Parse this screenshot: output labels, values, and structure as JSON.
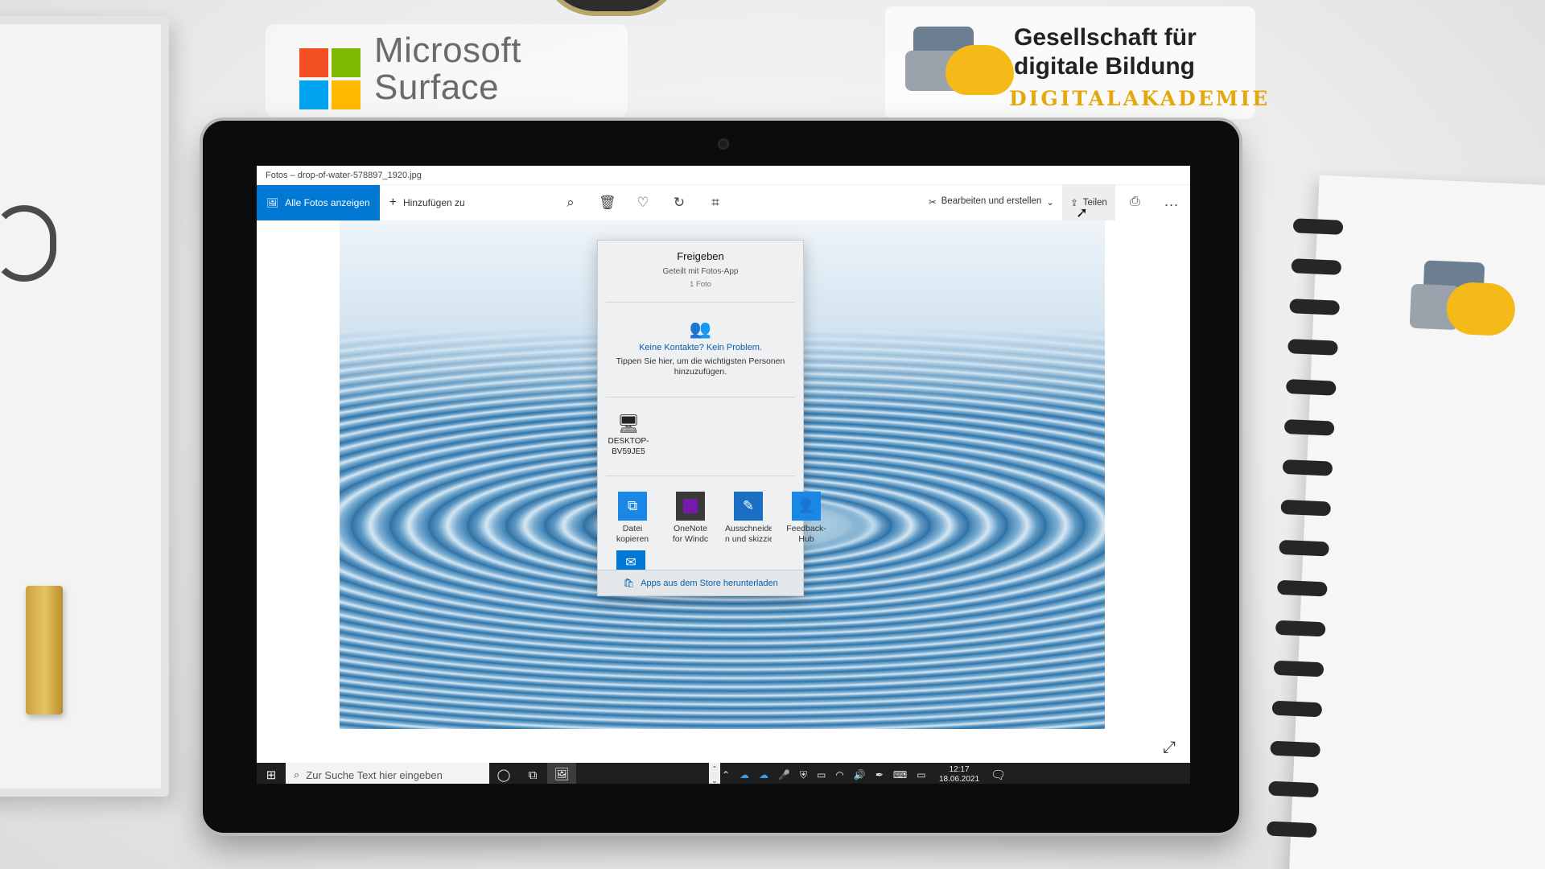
{
  "desk": {
    "ms_brand": "Microsoft Surface",
    "ms_brand_line1": "Microsoft",
    "ms_brand_line2": "Surface",
    "gdb_line1": "Gesellschaft für",
    "gdb_line2": "digitale Bildung",
    "gdb_line3": "DIGITALAKADEMIE"
  },
  "window": {
    "title": "Fotos – drop-of-water-578897_1920.jpg"
  },
  "toolbar": {
    "all_photos": "Alle Fotos anzeigen",
    "add_to": "Hinzufügen zu",
    "icons": [
      "zoom-icon",
      "delete-icon",
      "favorite-icon",
      "rotate-icon",
      "crop-icon"
    ],
    "edit_create": "Bearbeiten und erstellen",
    "share": "Teilen",
    "more": "..."
  },
  "share_panel": {
    "title": "Freigeben",
    "subtitle": "Geteilt mit Fotos-App",
    "count": "1 Foto",
    "contacts_heading": "Keine Kontakte? Kein Problem.",
    "contacts_text": "Tippen Sie hier, um die wichtigsten Personen hinzuzufügen.",
    "device_line1": "DESKTOP-",
    "device_line2": "BV59JE5",
    "apps": [
      {
        "line1": "Datei",
        "line2": "kopieren",
        "color": "#1b87e5",
        "icon": "copy-icon"
      },
      {
        "line1": "OneNote",
        "line2": "for Windc",
        "color": "#3a3a3a",
        "icon": "onenote-icon"
      },
      {
        "line1": "Ausschneide",
        "line2": "n und skizzie",
        "color": "#1a6fc4",
        "icon": "snip-sketch-icon"
      },
      {
        "line1": "Feedback-",
        "line2": "Hub",
        "color": "#1b87e5",
        "icon": "feedback-hub-icon"
      }
    ],
    "store_link": "Apps aus dem Store herunterladen"
  },
  "taskbar": {
    "search_placeholder": "Zur Suche Text hier eingeben",
    "time": "12:17",
    "date": "18.06.2021"
  },
  "colors": {
    "accent": "#0078d4",
    "link": "#0b5cad",
    "taskbar": "#1f1f1f"
  }
}
